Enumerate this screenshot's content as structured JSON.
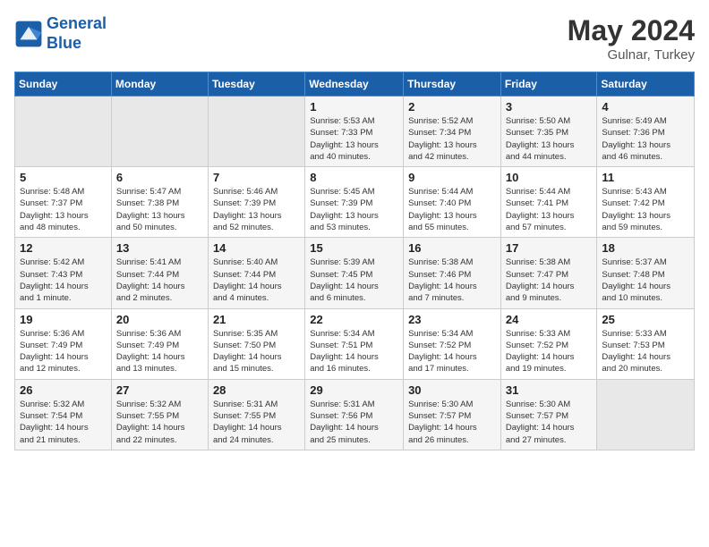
{
  "header": {
    "logo_line1": "General",
    "logo_line2": "Blue",
    "month": "May 2024",
    "location": "Gulnar, Turkey"
  },
  "weekdays": [
    "Sunday",
    "Monday",
    "Tuesday",
    "Wednesday",
    "Thursday",
    "Friday",
    "Saturday"
  ],
  "weeks": [
    [
      {
        "day": "",
        "info": ""
      },
      {
        "day": "",
        "info": ""
      },
      {
        "day": "",
        "info": ""
      },
      {
        "day": "1",
        "info": "Sunrise: 5:53 AM\nSunset: 7:33 PM\nDaylight: 13 hours\nand 40 minutes."
      },
      {
        "day": "2",
        "info": "Sunrise: 5:52 AM\nSunset: 7:34 PM\nDaylight: 13 hours\nand 42 minutes."
      },
      {
        "day": "3",
        "info": "Sunrise: 5:50 AM\nSunset: 7:35 PM\nDaylight: 13 hours\nand 44 minutes."
      },
      {
        "day": "4",
        "info": "Sunrise: 5:49 AM\nSunset: 7:36 PM\nDaylight: 13 hours\nand 46 minutes."
      }
    ],
    [
      {
        "day": "5",
        "info": "Sunrise: 5:48 AM\nSunset: 7:37 PM\nDaylight: 13 hours\nand 48 minutes."
      },
      {
        "day": "6",
        "info": "Sunrise: 5:47 AM\nSunset: 7:38 PM\nDaylight: 13 hours\nand 50 minutes."
      },
      {
        "day": "7",
        "info": "Sunrise: 5:46 AM\nSunset: 7:39 PM\nDaylight: 13 hours\nand 52 minutes."
      },
      {
        "day": "8",
        "info": "Sunrise: 5:45 AM\nSunset: 7:39 PM\nDaylight: 13 hours\nand 53 minutes."
      },
      {
        "day": "9",
        "info": "Sunrise: 5:44 AM\nSunset: 7:40 PM\nDaylight: 13 hours\nand 55 minutes."
      },
      {
        "day": "10",
        "info": "Sunrise: 5:44 AM\nSunset: 7:41 PM\nDaylight: 13 hours\nand 57 minutes."
      },
      {
        "day": "11",
        "info": "Sunrise: 5:43 AM\nSunset: 7:42 PM\nDaylight: 13 hours\nand 59 minutes."
      }
    ],
    [
      {
        "day": "12",
        "info": "Sunrise: 5:42 AM\nSunset: 7:43 PM\nDaylight: 14 hours\nand 1 minute."
      },
      {
        "day": "13",
        "info": "Sunrise: 5:41 AM\nSunset: 7:44 PM\nDaylight: 14 hours\nand 2 minutes."
      },
      {
        "day": "14",
        "info": "Sunrise: 5:40 AM\nSunset: 7:44 PM\nDaylight: 14 hours\nand 4 minutes."
      },
      {
        "day": "15",
        "info": "Sunrise: 5:39 AM\nSunset: 7:45 PM\nDaylight: 14 hours\nand 6 minutes."
      },
      {
        "day": "16",
        "info": "Sunrise: 5:38 AM\nSunset: 7:46 PM\nDaylight: 14 hours\nand 7 minutes."
      },
      {
        "day": "17",
        "info": "Sunrise: 5:38 AM\nSunset: 7:47 PM\nDaylight: 14 hours\nand 9 minutes."
      },
      {
        "day": "18",
        "info": "Sunrise: 5:37 AM\nSunset: 7:48 PM\nDaylight: 14 hours\nand 10 minutes."
      }
    ],
    [
      {
        "day": "19",
        "info": "Sunrise: 5:36 AM\nSunset: 7:49 PM\nDaylight: 14 hours\nand 12 minutes."
      },
      {
        "day": "20",
        "info": "Sunrise: 5:36 AM\nSunset: 7:49 PM\nDaylight: 14 hours\nand 13 minutes."
      },
      {
        "day": "21",
        "info": "Sunrise: 5:35 AM\nSunset: 7:50 PM\nDaylight: 14 hours\nand 15 minutes."
      },
      {
        "day": "22",
        "info": "Sunrise: 5:34 AM\nSunset: 7:51 PM\nDaylight: 14 hours\nand 16 minutes."
      },
      {
        "day": "23",
        "info": "Sunrise: 5:34 AM\nSunset: 7:52 PM\nDaylight: 14 hours\nand 17 minutes."
      },
      {
        "day": "24",
        "info": "Sunrise: 5:33 AM\nSunset: 7:52 PM\nDaylight: 14 hours\nand 19 minutes."
      },
      {
        "day": "25",
        "info": "Sunrise: 5:33 AM\nSunset: 7:53 PM\nDaylight: 14 hours\nand 20 minutes."
      }
    ],
    [
      {
        "day": "26",
        "info": "Sunrise: 5:32 AM\nSunset: 7:54 PM\nDaylight: 14 hours\nand 21 minutes."
      },
      {
        "day": "27",
        "info": "Sunrise: 5:32 AM\nSunset: 7:55 PM\nDaylight: 14 hours\nand 22 minutes."
      },
      {
        "day": "28",
        "info": "Sunrise: 5:31 AM\nSunset: 7:55 PM\nDaylight: 14 hours\nand 24 minutes."
      },
      {
        "day": "29",
        "info": "Sunrise: 5:31 AM\nSunset: 7:56 PM\nDaylight: 14 hours\nand 25 minutes."
      },
      {
        "day": "30",
        "info": "Sunrise: 5:30 AM\nSunset: 7:57 PM\nDaylight: 14 hours\nand 26 minutes."
      },
      {
        "day": "31",
        "info": "Sunrise: 5:30 AM\nSunset: 7:57 PM\nDaylight: 14 hours\nand 27 minutes."
      },
      {
        "day": "",
        "info": ""
      }
    ]
  ]
}
